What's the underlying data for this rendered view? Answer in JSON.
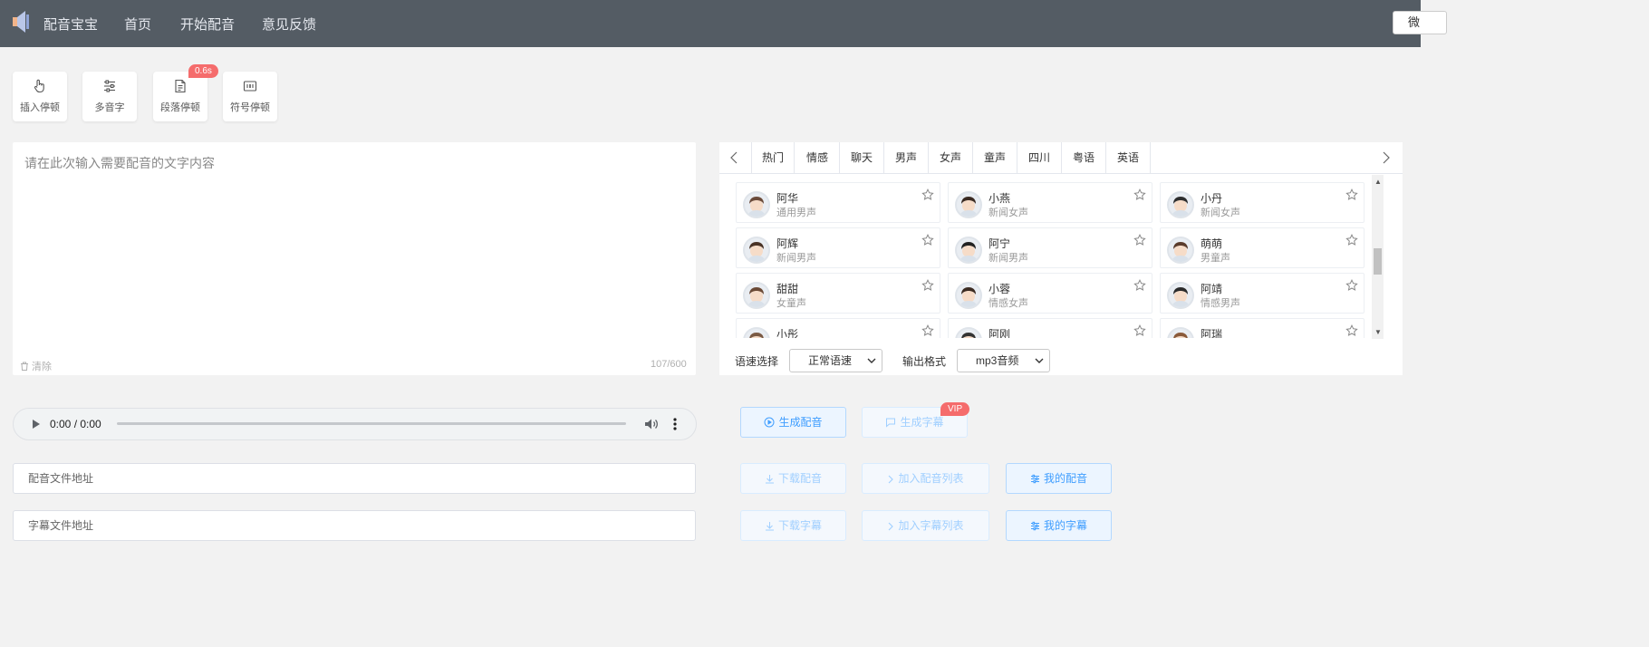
{
  "nav": {
    "brand": "配音宝宝",
    "items": [
      {
        "label": "首页"
      },
      {
        "label": "开始配音"
      },
      {
        "label": "意见反馈"
      }
    ],
    "right_button": "微"
  },
  "toolbar": {
    "items": [
      {
        "label": "插入停顿",
        "icon": "hand-pointer-icon"
      },
      {
        "label": "多音字",
        "icon": "sliders-icon"
      },
      {
        "label": "段落停顿",
        "icon": "document-icon"
      },
      {
        "label": "符号停顿",
        "icon": "symbol-box-icon"
      }
    ],
    "badge": "0.6s"
  },
  "editor": {
    "placeholder": "请在此次输入需要配音的文字内容",
    "value": "",
    "clear_label": "清除",
    "counter": "107/600"
  },
  "voice_panel": {
    "tabs": [
      "热门",
      "情感",
      "聊天",
      "男声",
      "女声",
      "童声",
      "四川",
      "粤语",
      "英语"
    ],
    "voices": [
      {
        "name": "阿华",
        "desc": "通用男声"
      },
      {
        "name": "小燕",
        "desc": "新闻女声"
      },
      {
        "name": "小丹",
        "desc": "新闻女声"
      },
      {
        "name": "阿辉",
        "desc": "新闻男声"
      },
      {
        "name": "阿宁",
        "desc": "新闻男声"
      },
      {
        "name": "萌萌",
        "desc": "男童声"
      },
      {
        "name": "甜甜",
        "desc": "女童声"
      },
      {
        "name": "小蓉",
        "desc": "情感女声"
      },
      {
        "name": "阿靖",
        "desc": "情感男声"
      },
      {
        "name": "小彤",
        "desc": ""
      },
      {
        "name": "阿刚",
        "desc": ""
      },
      {
        "name": "阿瑞",
        "desc": ""
      }
    ],
    "speed_label": "语速选择",
    "speed_value": "正常语速",
    "format_label": "输出格式",
    "format_value": "mp3音频"
  },
  "player": {
    "time": "0:00 / 0:00",
    "progress": 0
  },
  "fields": {
    "audio_url_placeholder": "配音文件地址",
    "subtitle_url_placeholder": "字幕文件地址"
  },
  "actions": {
    "generate_audio": "生成配音",
    "generate_subtitle": "生成字幕",
    "vip_badge": "VIP",
    "download_audio": "下载配音",
    "add_audio_list": "加入配音列表",
    "my_audio": "我的配音",
    "download_subtitle": "下载字幕",
    "add_subtitle_list": "加入字幕列表",
    "my_subtitle": "我的字幕"
  },
  "colors": {
    "nav_bg": "#545c64",
    "primary": "#409eff",
    "badge_red": "#f56c6c"
  }
}
